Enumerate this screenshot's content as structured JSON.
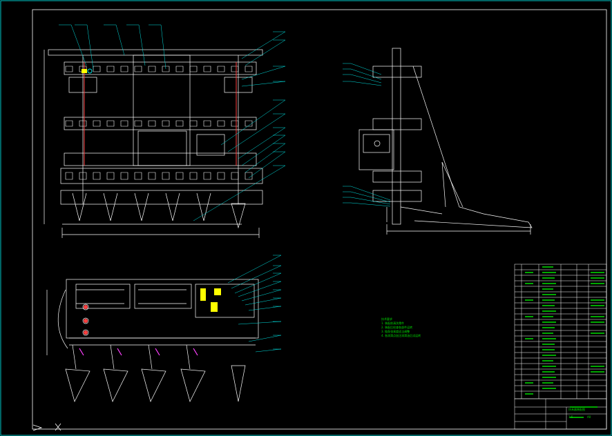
{
  "drawing": {
    "colors": {
      "background": "#000000",
      "frame": "#00c8c8",
      "geometry": "#ffffff",
      "leader": "#00e5e5",
      "text": "#00e000",
      "highlight": "#ffff00",
      "accent": "#ff4040",
      "magenta": "#ff40ff"
    },
    "notes": {
      "title": "技术要求",
      "items": [
        "1. 装配前清洗零件",
        "2. 装配后检查各部件运转",
        "3. 链条张紧度适当调整",
        "4. 各润滑点加注润滑油后试运转"
      ]
    },
    "title_block": {
      "name": "扶禾器装配图",
      "scale": "1:5",
      "sheet": "A0"
    }
  }
}
